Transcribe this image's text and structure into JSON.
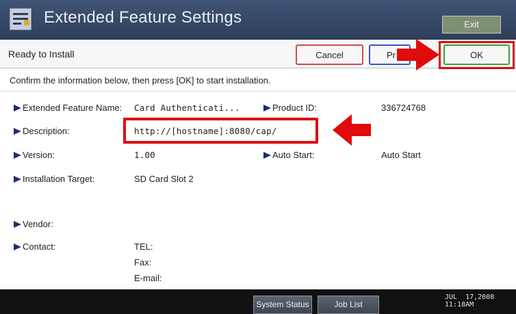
{
  "header": {
    "title": "Extended Feature Settings",
    "exit_label": "Exit",
    "icon": "settings-panel-icon"
  },
  "status": {
    "text": "Ready to Install",
    "cancel_label": "Cancel",
    "print_label": "Pr",
    "ok_label": "OK"
  },
  "instructions": "Confirm the information below, then press [OK] to start installation.",
  "details": {
    "feature_name_label": "Extended Feature Name:",
    "feature_name_value": "Card Authenticati...",
    "product_id_label": "Product ID:",
    "product_id_value": "336724768",
    "description_label": "Description:",
    "description_value": "http://[hostname]:8080/cap/",
    "version_label": "Version:",
    "version_value": "1.00",
    "auto_start_label": "Auto Start:",
    "auto_start_value": "Auto Start",
    "installation_target_label": "Installation Target:",
    "installation_target_value": "SD Card Slot 2",
    "vendor_label": "Vendor:",
    "contact_label": "Contact:",
    "contact_tel_label": "TEL:",
    "contact_fax_label": "Fax:",
    "contact_email_label": "E-mail:"
  },
  "footer": {
    "system_status_label": "System Status",
    "job_list_label": "Job List",
    "date": "JUL  17,2008",
    "time": "11:18AM"
  },
  "colors": {
    "title_bar": "#344866",
    "annotation_red": "#e00b0b",
    "ok_border": "#38a33c",
    "cancel_border": "#d04a4a",
    "print_border": "#3a55c9"
  }
}
